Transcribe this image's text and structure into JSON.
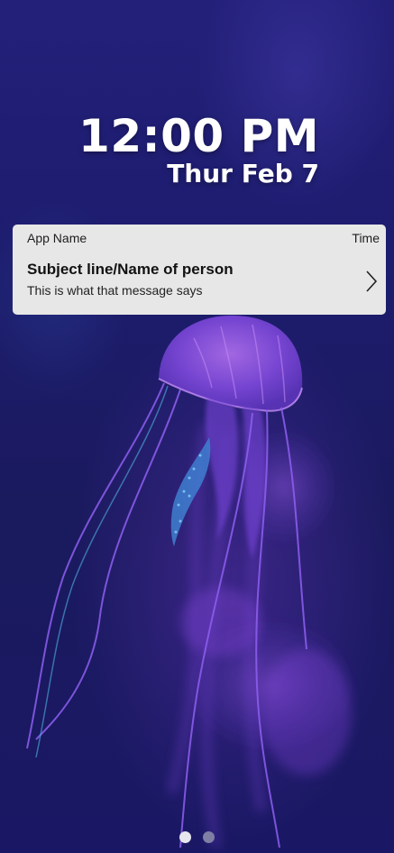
{
  "lock_screen": {
    "time": "12:00 PM",
    "date": "Thur Feb 7"
  },
  "notification": {
    "app_name": "App Name",
    "time": "Time",
    "subject": "Subject line/Name of person",
    "message": "This is what that message says",
    "chevron_icon": "chevron-right-icon"
  },
  "wallpaper": {
    "description_icon": "jellyfish-wallpaper"
  },
  "page_indicator": {
    "pages": 2,
    "current_page": 1,
    "active_color": "#e6e6ee",
    "inactive_color": "#7f7fa6"
  },
  "colors": {
    "notification_bg": "#e7e7e7",
    "clock_text": "#ffffff"
  }
}
